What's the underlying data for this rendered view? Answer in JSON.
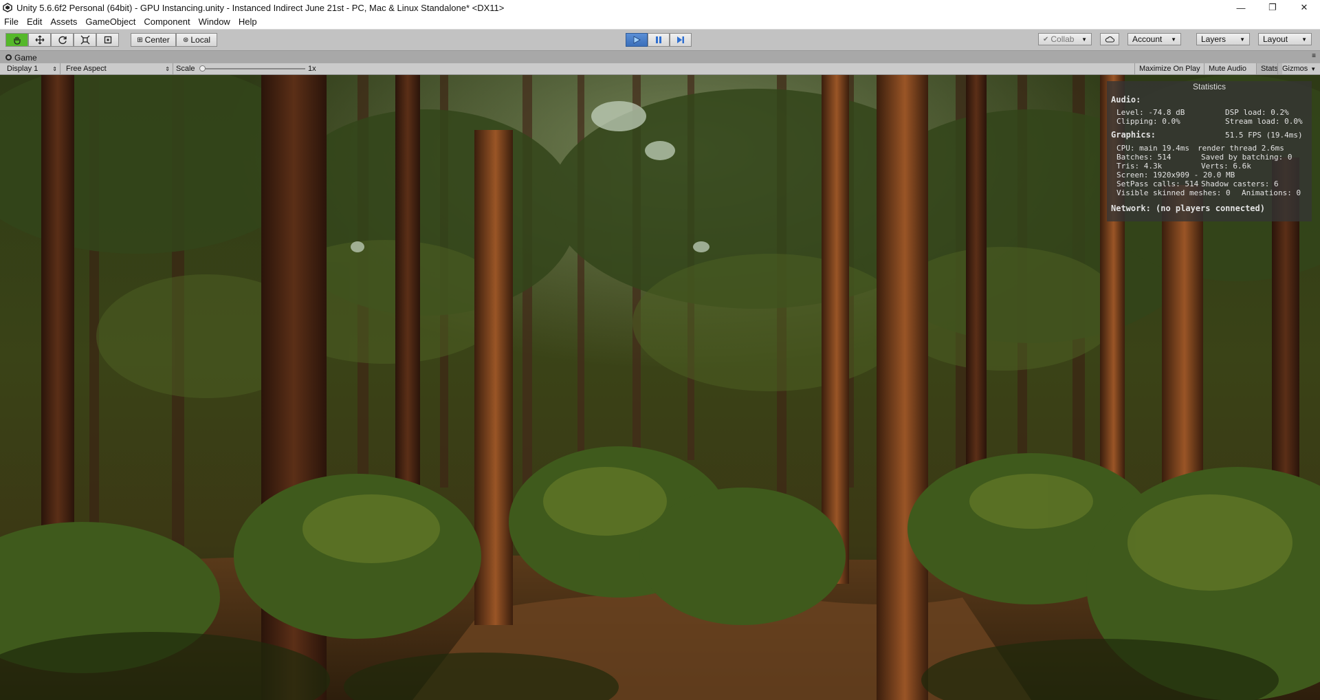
{
  "window": {
    "title": "Unity 5.6.6f2 Personal (64bit) - GPU Instancing.unity - Instanced Indirect June 21st - PC, Mac & Linux Standalone* <DX11>",
    "controls": {
      "minimize": "—",
      "restore": "❐",
      "close": "✕"
    }
  },
  "menu": [
    "File",
    "Edit",
    "Assets",
    "GameObject",
    "Component",
    "Window",
    "Help"
  ],
  "toolbar": {
    "tools": [
      "hand-tool",
      "move-tool",
      "rotate-tool",
      "scale-tool",
      "rect-tool"
    ],
    "pivot_label": "Center",
    "space_label": "Local",
    "collab_label": "Collab",
    "account_label": "Account",
    "layers_label": "Layers",
    "layout_label": "Layout"
  },
  "game_tab": {
    "label": "Game"
  },
  "game_bar": {
    "display": "Display 1",
    "aspect": "Free Aspect",
    "scale_label": "Scale",
    "scale_value": "1x",
    "scale_fraction": 0.0,
    "maximize_on_play": "Maximize On Play",
    "mute_audio": "Mute Audio",
    "stats": "Stats",
    "gizmos": "Gizmos"
  },
  "stats": {
    "header": "Statistics",
    "audio_title": "Audio:",
    "level": "Level: -74.8 dB",
    "clipping": "Clipping: 0.0%",
    "dsp_load": "DSP load: 0.2%",
    "stream_load": "Stream load: 0.0%",
    "graphics_title": "Graphics:",
    "fps": "51.5 FPS (19.4ms)",
    "cpu": "CPU: main 19.4ms",
    "render_thread": "render thread 2.6ms",
    "batches": "Batches: 514",
    "saved_by_batching": "Saved by batching: 0",
    "tris": "Tris: 4.3k",
    "verts": "Verts: 6.6k",
    "screen": "Screen: 1920x909 - 20.0 MB",
    "setpass": "SetPass calls: 514",
    "shadow_casters": "Shadow casters: 6",
    "skinned": "Visible skinned meshes: 0",
    "animations": "Animations: 0",
    "network": "Network: (no players connected)"
  },
  "colors": {
    "play_active": "#3b6fba",
    "hand_tool_selected": "#55b82a",
    "editor_gray": "#c2c2c2"
  }
}
